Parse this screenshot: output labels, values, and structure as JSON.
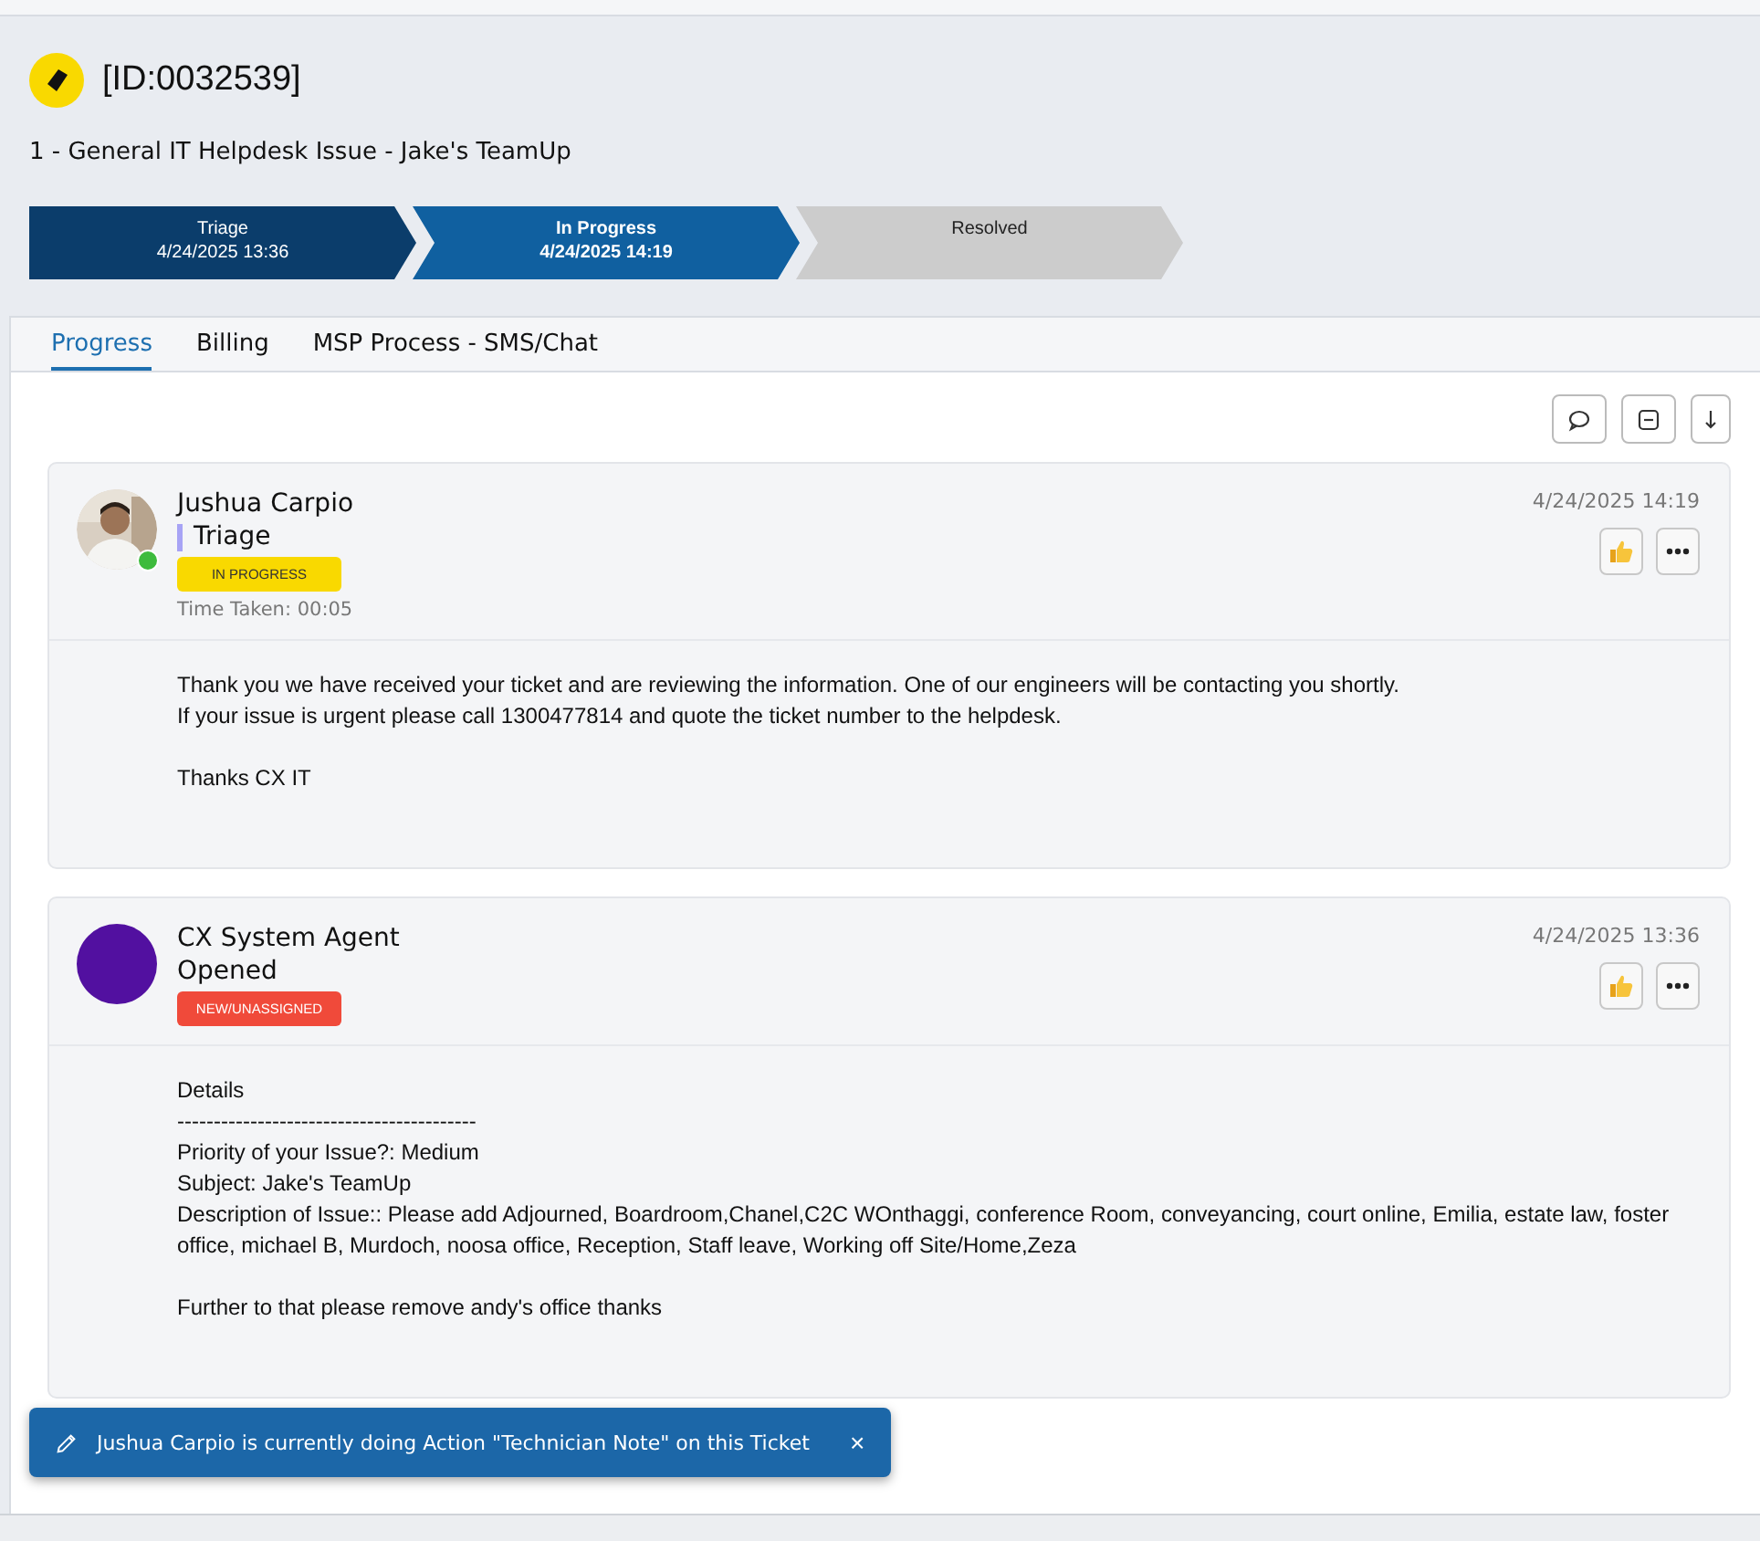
{
  "ticket": {
    "id": "[ID:0032539]",
    "title": "1 - General IT Helpdesk Issue - Jake's TeamUp"
  },
  "stages": [
    {
      "name": "Triage",
      "date": "4/24/2025 13:36",
      "completed": true,
      "selected": false
    },
    {
      "name": "In Progress",
      "date": "4/24/2025 14:19",
      "completed": true,
      "selected": true
    },
    {
      "name": "Resolved",
      "completed": false,
      "selected": false
    }
  ],
  "tabs": [
    {
      "label": "Progress",
      "selected": true
    },
    {
      "label": "Billing",
      "selected": false
    },
    {
      "label": "MSP Process - SMS/Chat",
      "selected": false
    }
  ],
  "entries": [
    {
      "author": "Jushua Carpio",
      "avatar": {
        "kind": "picture"
      },
      "online": true,
      "stage": "Triage",
      "stage_marker": true,
      "badge": {
        "text": "IN PROGRESS",
        "color": "#f9d900"
      },
      "time_taken": "Time Taken: 00:05",
      "date": "4/24/2025 14:19",
      "body": [
        [
          "Thank you we have received your ticket and are reviewing the information. One of our engineers will be contacting you shortly.",
          "If your issue is urgent please call 1300477814 and quote the ticket number to the helpdesk."
        ],
        [
          "Thanks CX IT"
        ]
      ]
    },
    {
      "author": "CX System Agent",
      "avatar": {
        "color": "#5210a0"
      },
      "online": false,
      "stage": "Opened",
      "stage_marker": false,
      "badge": {
        "text": "NEW/UNASSIGNED",
        "color": "#f04a3a"
      },
      "date": "4/24/2025 13:36",
      "body": [
        [
          "Details",
          "-----------------------------------------",
          "Priority of your Issue?: Medium",
          "Subject: Jake's TeamUp",
          "Description of Issue:: Please add Adjourned, Boardroom,Chanel,C2C WOnthaggi, conference Room, conveyancing, court online, Emilia, estate law, foster office, michael B, Murdoch, noosa office, Reception, Staff leave, Working off Site/Home,Zeza"
        ],
        [
          "Further to that please remove andy's office thanks"
        ]
      ]
    }
  ],
  "toast": {
    "message": "Jushua Carpio is currently doing Action \"Technician Note\" on this Ticket",
    "close": "×"
  }
}
